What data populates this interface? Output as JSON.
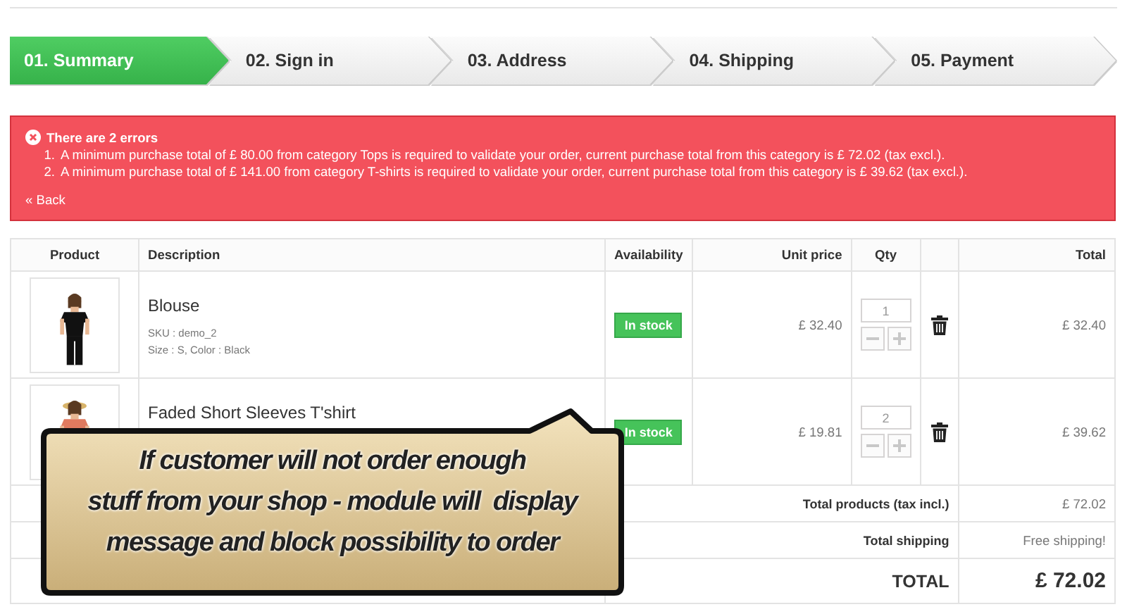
{
  "steps": [
    {
      "label": "01. Summary",
      "selected": true
    },
    {
      "label": "02. Sign in",
      "selected": false
    },
    {
      "label": "03. Address",
      "selected": false
    },
    {
      "label": "04. Shipping",
      "selected": false
    },
    {
      "label": "05. Payment",
      "selected": false
    }
  ],
  "error": {
    "title": "There are 2 errors",
    "items": [
      {
        "marker": "1.",
        "text": "A minimum purchase total of £ 80.00 from category Tops is required to validate your order, current purchase total from this category is £ 72.02 (tax excl.)."
      },
      {
        "marker": "2.",
        "text": "A minimum purchase total of £ 141.00 from category T-shirts is required to validate your order, current purchase total from this category is £ 39.62 (tax excl.)."
      }
    ],
    "back_link": "« Back"
  },
  "cart": {
    "columns": [
      "Product",
      "Description",
      "Availability",
      "Unit price",
      "Qty",
      "Total"
    ],
    "rows": [
      {
        "name": "Blouse",
        "sku": "SKU : demo_2",
        "attributes": "Size : S, Color : Black",
        "availability": "In stock",
        "unit_price": "£ 32.40",
        "qty": "1",
        "total": "£ 32.40"
      },
      {
        "name": "Faded Short Sleeves T'shirt",
        "availability": "In stock",
        "unit_price": "£ 19.81",
        "qty": "2",
        "total": "£ 39.62"
      }
    ],
    "summary": [
      {
        "kind": "normal",
        "label": "Total products (tax incl.)",
        "value": "£ 72.02"
      },
      {
        "kind": "normal",
        "label": "Total shipping",
        "value": "Free shipping!"
      },
      {
        "kind": "grand",
        "label": "TOTAL",
        "value": "£ 72.02"
      }
    ]
  },
  "callout": {
    "lines": [
      "If customer will not order enough",
      "stuff from your shop - module will  display",
      "message and block possibility to order"
    ]
  }
}
